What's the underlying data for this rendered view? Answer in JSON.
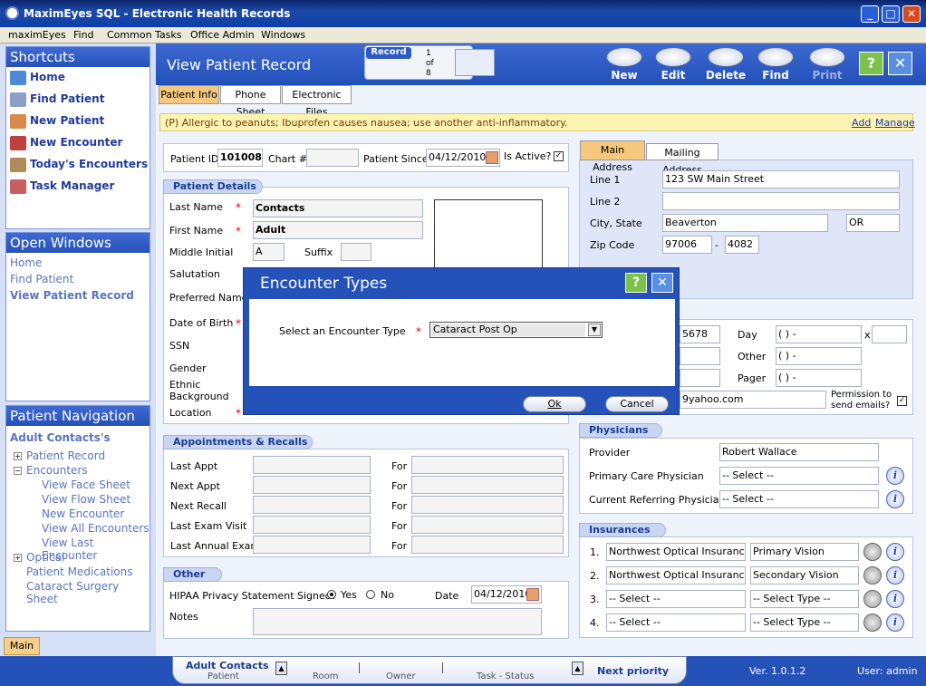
{
  "window": {
    "title": "MaximEyes SQL - Electronic Health Records"
  },
  "menu": [
    "maximEyes",
    "Find",
    "Common Tasks",
    "Office Admin",
    "Windows"
  ],
  "shortcuts": {
    "header": "Shortcuts",
    "items": [
      "Home",
      "Find Patient",
      "New Patient",
      "New Encounter",
      "Today's Encounters",
      "Task Manager"
    ]
  },
  "open_windows": {
    "header": "Open Windows",
    "items": [
      "Home",
      "Find Patient",
      "View Patient Record"
    ]
  },
  "patient_nav": {
    "header": "Patient Navigation",
    "patient": "Adult Contacts's",
    "tree": [
      "Patient Record",
      "Encounters",
      "View Face Sheet",
      "View Flow Sheet",
      "New Encounter",
      "View All Encounters",
      "View Last Encounter",
      "Optical",
      "Patient Medications",
      "Cataract Surgery Sheet"
    ]
  },
  "left_tab": "Main",
  "header": {
    "title": "View Patient Record",
    "record_label": "Record",
    "record_num": "1",
    "record_of": "of",
    "record_total": "8"
  },
  "toolbar": [
    "New",
    "Edit",
    "Delete",
    "Find",
    "Print"
  ],
  "tabs": [
    "Patient Info",
    "Phone Sheet",
    "Electronic Files"
  ],
  "alert": {
    "text": "(P) Allergic to peanuts; Ibuprofen causes nausea; use another anti-inflammatory.",
    "add": "Add",
    "manage": "Manage"
  },
  "id_row": {
    "patient_id_label": "Patient ID",
    "patient_id": "101008",
    "chart_label": "Chart #",
    "chart": "",
    "since_label": "Patient Since",
    "since": "04/12/2010",
    "active_label": "Is Active?"
  },
  "details": {
    "header": "Patient Details",
    "last_name_label": "Last Name",
    "last_name": "Contacts",
    "first_name_label": "First Name",
    "first_name": "Adult",
    "mi_label": "Middle Initial",
    "mi": "A",
    "suffix_label": "Suffix",
    "salutation_label": "Salutation",
    "preferred_label": "Preferred Name",
    "dob_label": "Date of Birth",
    "ssn_label": "SSN",
    "gender_label": "Gender",
    "ethnic_label": "Ethnic Background",
    "location_label": "Location"
  },
  "address": {
    "tab_main": "Main Address",
    "tab_mailing": "Mailing Address",
    "line1_label": "Line 1",
    "line1": "123 SW Main Street",
    "line2_label": "Line 2",
    "city_label": "City, State",
    "city": "Beaverton",
    "state": "OR",
    "zip_label": "Zip Code",
    "zip": "97006",
    "zip_sep": "-",
    "zip4": "4082"
  },
  "phones": {
    "partial": "5678",
    "day_label": "Day",
    "other_label": "Other",
    "pager_label": "Pager",
    "blank_phone": "(   )     -",
    "x": "x",
    "email": "9yahoo.com",
    "perm_label": "Permission to send emails?"
  },
  "appointments": {
    "header": "Appointments & Recalls",
    "rows": [
      "Last Appt",
      "Next Appt",
      "Next Recall",
      "Last Exam Visit",
      "Last Annual Exam"
    ],
    "for": "For"
  },
  "other": {
    "header": "Other",
    "hipaa_label": "HIPAA Privacy Statement Signed?",
    "yes": "Yes",
    "no": "No",
    "date_label": "Date",
    "date": "04/12/2010",
    "notes_label": "Notes"
  },
  "physicians": {
    "header": "Physicians",
    "provider_label": "Provider",
    "provider": "Robert Wallace",
    "pcp_label": "Primary Care Physician",
    "pcp": "-- Select --",
    "ref_label": "Current Referring Physician",
    "ref": "-- Select --"
  },
  "insurances": {
    "header": "Insurances",
    "rows": [
      {
        "n": "1.",
        "name": "Northwest Optical Insurance Co",
        "type": "Primary Vision"
      },
      {
        "n": "2.",
        "name": "Northwest Optical Insurance Co",
        "type": "Secondary Vision"
      },
      {
        "n": "3.",
        "name": "-- Select --",
        "type": "-- Select Type --"
      },
      {
        "n": "4.",
        "name": "-- Select --",
        "type": "-- Select Type --"
      }
    ]
  },
  "dialog": {
    "title": "Encounter Types",
    "label": "Select an Encounter Type",
    "value": "Cataract Post Op",
    "ok": "Ok",
    "cancel": "Cancel"
  },
  "status": {
    "patient_name": "Adult Contacts",
    "patient_label": "Patient",
    "room_label": "Room",
    "owner_label": "Owner",
    "task_label": "Task - Status",
    "next_priority": "Next priority",
    "version": "Ver. 1.0.1.2",
    "user": "User: admin"
  }
}
